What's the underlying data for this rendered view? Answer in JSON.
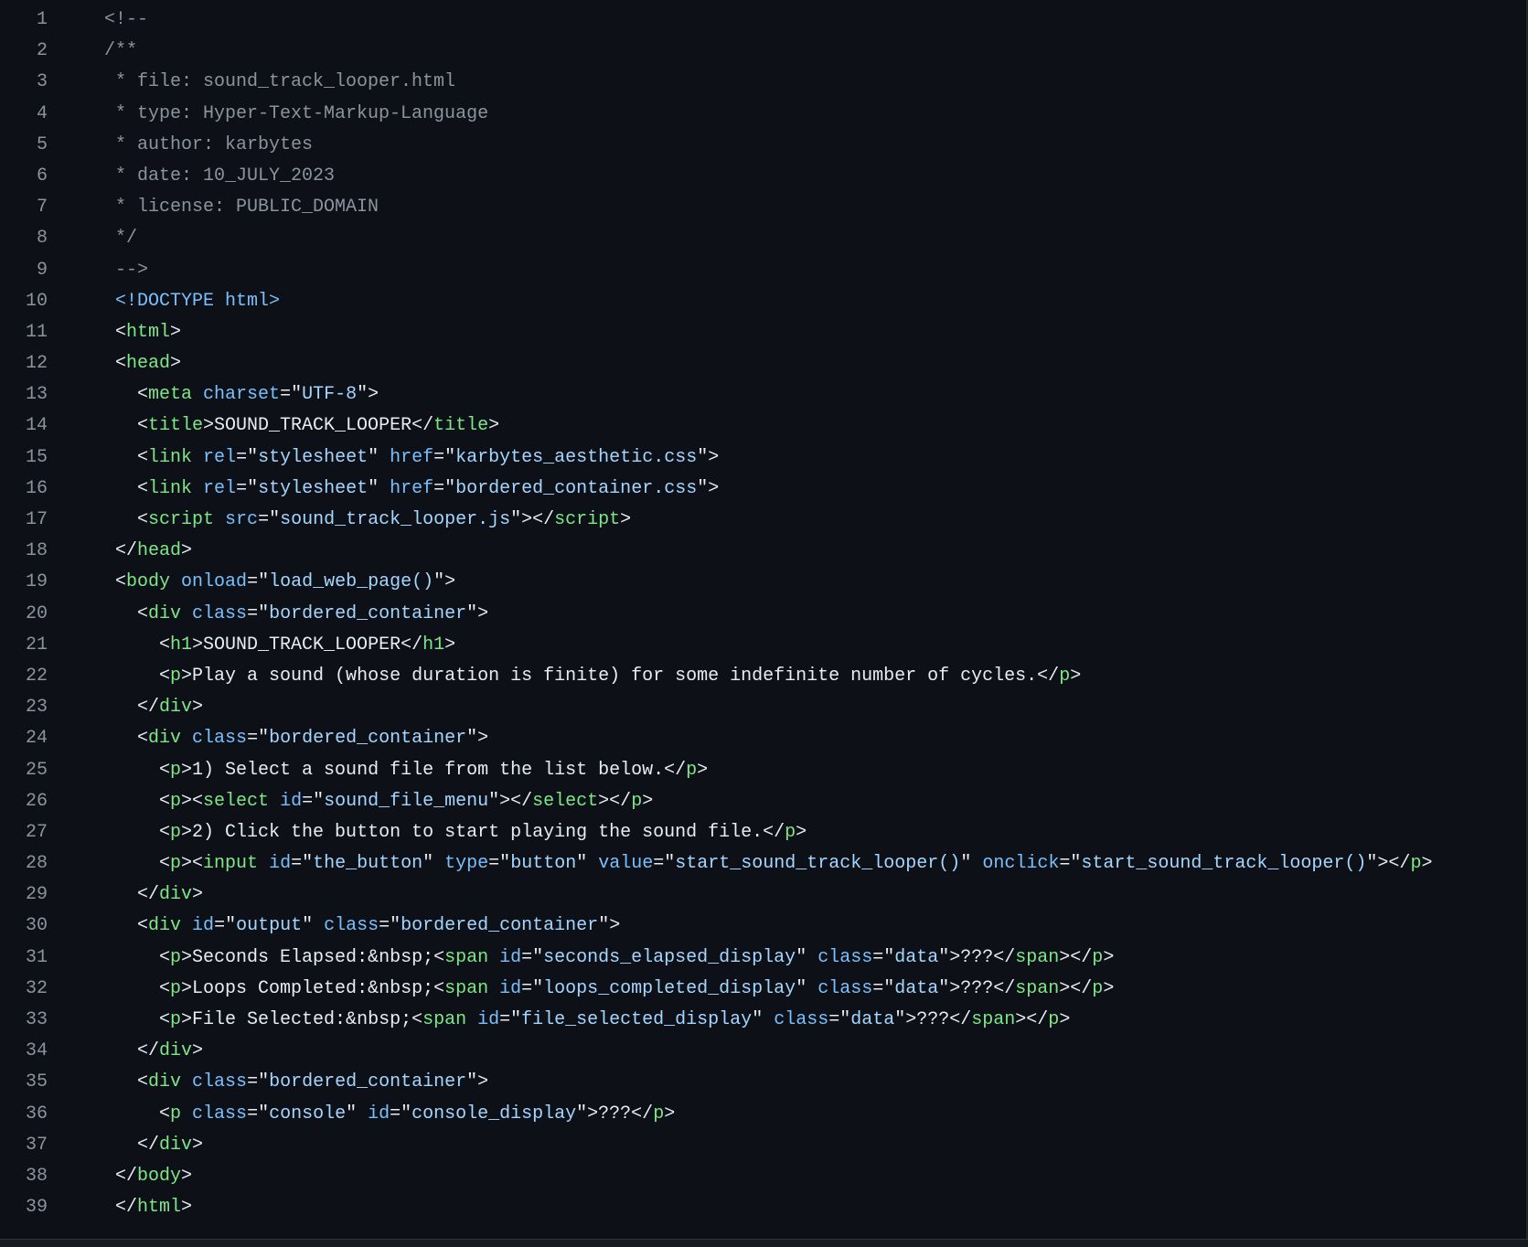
{
  "editor": {
    "lines": [
      [
        [
          "c",
          "<!--"
        ]
      ],
      [
        [
          "c",
          "/**"
        ]
      ],
      [
        [
          "c",
          " * file: sound_track_looper.html"
        ]
      ],
      [
        [
          "c",
          " * type: Hyper-Text-Markup-Language"
        ]
      ],
      [
        [
          "c",
          " * author: karbytes"
        ]
      ],
      [
        [
          "c",
          " * date: 10_JULY_2023"
        ]
      ],
      [
        [
          "c",
          " * license: PUBLIC_DOMAIN"
        ]
      ],
      [
        [
          "c",
          " */"
        ]
      ],
      [
        [
          "c",
          " -->"
        ]
      ],
      [
        [
          "x",
          " "
        ],
        [
          "d",
          "<!DOCTYPE html>"
        ]
      ],
      [
        [
          "x",
          " <"
        ],
        [
          "t",
          "html"
        ],
        [
          "x",
          ">"
        ]
      ],
      [
        [
          "x",
          " <"
        ],
        [
          "t",
          "head"
        ],
        [
          "x",
          ">"
        ]
      ],
      [
        [
          "x",
          "   <"
        ],
        [
          "t",
          "meta"
        ],
        [
          "x",
          " "
        ],
        [
          "a",
          "charset"
        ],
        [
          "x",
          "=\""
        ],
        [
          "s",
          "UTF-8"
        ],
        [
          "x",
          "\">"
        ]
      ],
      [
        [
          "x",
          "   <"
        ],
        [
          "t",
          "title"
        ],
        [
          "x",
          ">SOUND_TRACK_LOOPER</"
        ],
        [
          "t",
          "title"
        ],
        [
          "x",
          ">"
        ]
      ],
      [
        [
          "x",
          "   <"
        ],
        [
          "t",
          "link"
        ],
        [
          "x",
          " "
        ],
        [
          "a",
          "rel"
        ],
        [
          "x",
          "=\""
        ],
        [
          "s",
          "stylesheet"
        ],
        [
          "x",
          "\" "
        ],
        [
          "a",
          "href"
        ],
        [
          "x",
          "=\""
        ],
        [
          "s",
          "karbytes_aesthetic.css"
        ],
        [
          "x",
          "\">"
        ]
      ],
      [
        [
          "x",
          "   <"
        ],
        [
          "t",
          "link"
        ],
        [
          "x",
          " "
        ],
        [
          "a",
          "rel"
        ],
        [
          "x",
          "=\""
        ],
        [
          "s",
          "stylesheet"
        ],
        [
          "x",
          "\" "
        ],
        [
          "a",
          "href"
        ],
        [
          "x",
          "=\""
        ],
        [
          "s",
          "bordered_container.css"
        ],
        [
          "x",
          "\">"
        ]
      ],
      [
        [
          "x",
          "   <"
        ],
        [
          "t",
          "script"
        ],
        [
          "x",
          " "
        ],
        [
          "a",
          "src"
        ],
        [
          "x",
          "=\""
        ],
        [
          "s",
          "sound_track_looper.js"
        ],
        [
          "x",
          "\"></"
        ],
        [
          "t",
          "script"
        ],
        [
          "x",
          ">"
        ]
      ],
      [
        [
          "x",
          " </"
        ],
        [
          "t",
          "head"
        ],
        [
          "x",
          ">"
        ]
      ],
      [
        [
          "x",
          " <"
        ],
        [
          "t",
          "body"
        ],
        [
          "x",
          " "
        ],
        [
          "a",
          "onload"
        ],
        [
          "x",
          "=\""
        ],
        [
          "s",
          "load_web_page()"
        ],
        [
          "x",
          "\">"
        ]
      ],
      [
        [
          "x",
          "   <"
        ],
        [
          "t",
          "div"
        ],
        [
          "x",
          " "
        ],
        [
          "a",
          "class"
        ],
        [
          "x",
          "=\""
        ],
        [
          "s",
          "bordered_container"
        ],
        [
          "x",
          "\">"
        ]
      ],
      [
        [
          "x",
          "     <"
        ],
        [
          "t",
          "h1"
        ],
        [
          "x",
          ">SOUND_TRACK_LOOPER</"
        ],
        [
          "t",
          "h1"
        ],
        [
          "x",
          ">"
        ]
      ],
      [
        [
          "x",
          "     <"
        ],
        [
          "t",
          "p"
        ],
        [
          "x",
          ">Play a sound (whose duration is finite) for some indefinite number of cycles.</"
        ],
        [
          "t",
          "p"
        ],
        [
          "x",
          ">"
        ]
      ],
      [
        [
          "x",
          "   </"
        ],
        [
          "t",
          "div"
        ],
        [
          "x",
          ">"
        ]
      ],
      [
        [
          "x",
          "   <"
        ],
        [
          "t",
          "div"
        ],
        [
          "x",
          " "
        ],
        [
          "a",
          "class"
        ],
        [
          "x",
          "=\""
        ],
        [
          "s",
          "bordered_container"
        ],
        [
          "x",
          "\">"
        ]
      ],
      [
        [
          "x",
          "     <"
        ],
        [
          "t",
          "p"
        ],
        [
          "x",
          ">1) Select a sound file from the list below.</"
        ],
        [
          "t",
          "p"
        ],
        [
          "x",
          ">"
        ]
      ],
      [
        [
          "x",
          "     <"
        ],
        [
          "t",
          "p"
        ],
        [
          "x",
          "><"
        ],
        [
          "t",
          "select"
        ],
        [
          "x",
          " "
        ],
        [
          "a",
          "id"
        ],
        [
          "x",
          "=\""
        ],
        [
          "s",
          "sound_file_menu"
        ],
        [
          "x",
          "\"></"
        ],
        [
          "t",
          "select"
        ],
        [
          "x",
          "></"
        ],
        [
          "t",
          "p"
        ],
        [
          "x",
          ">"
        ]
      ],
      [
        [
          "x",
          "     <"
        ],
        [
          "t",
          "p"
        ],
        [
          "x",
          ">2) Click the button to start playing the sound file.</"
        ],
        [
          "t",
          "p"
        ],
        [
          "x",
          ">"
        ]
      ],
      [
        [
          "x",
          "     <"
        ],
        [
          "t",
          "p"
        ],
        [
          "x",
          "><"
        ],
        [
          "t",
          "input"
        ],
        [
          "x",
          " "
        ],
        [
          "a",
          "id"
        ],
        [
          "x",
          "=\""
        ],
        [
          "s",
          "the_button"
        ],
        [
          "x",
          "\" "
        ],
        [
          "a",
          "type"
        ],
        [
          "x",
          "=\""
        ],
        [
          "s",
          "button"
        ],
        [
          "x",
          "\" "
        ],
        [
          "a",
          "value"
        ],
        [
          "x",
          "=\""
        ],
        [
          "s",
          "start_sound_track_looper()"
        ],
        [
          "x",
          "\" "
        ],
        [
          "a",
          "onclick"
        ],
        [
          "x",
          "=\""
        ],
        [
          "s",
          "start_sound_track_looper()"
        ],
        [
          "x",
          "\"></"
        ],
        [
          "t",
          "p"
        ],
        [
          "x",
          ">"
        ]
      ],
      [
        [
          "x",
          "   </"
        ],
        [
          "t",
          "div"
        ],
        [
          "x",
          ">"
        ]
      ],
      [
        [
          "x",
          "   <"
        ],
        [
          "t",
          "div"
        ],
        [
          "x",
          " "
        ],
        [
          "a",
          "id"
        ],
        [
          "x",
          "=\""
        ],
        [
          "s",
          "output"
        ],
        [
          "x",
          "\" "
        ],
        [
          "a",
          "class"
        ],
        [
          "x",
          "=\""
        ],
        [
          "s",
          "bordered_container"
        ],
        [
          "x",
          "\">"
        ]
      ],
      [
        [
          "x",
          "     <"
        ],
        [
          "t",
          "p"
        ],
        [
          "x",
          ">Seconds Elapsed:&nbsp;<"
        ],
        [
          "t",
          "span"
        ],
        [
          "x",
          " "
        ],
        [
          "a",
          "id"
        ],
        [
          "x",
          "=\""
        ],
        [
          "s",
          "seconds_elapsed_display"
        ],
        [
          "x",
          "\" "
        ],
        [
          "a",
          "class"
        ],
        [
          "x",
          "=\""
        ],
        [
          "s",
          "data"
        ],
        [
          "x",
          "\">???</"
        ],
        [
          "t",
          "span"
        ],
        [
          "x",
          "></"
        ],
        [
          "t",
          "p"
        ],
        [
          "x",
          ">"
        ]
      ],
      [
        [
          "x",
          "     <"
        ],
        [
          "t",
          "p"
        ],
        [
          "x",
          ">Loops Completed:&nbsp;<"
        ],
        [
          "t",
          "span"
        ],
        [
          "x",
          " "
        ],
        [
          "a",
          "id"
        ],
        [
          "x",
          "=\""
        ],
        [
          "s",
          "loops_completed_display"
        ],
        [
          "x",
          "\" "
        ],
        [
          "a",
          "class"
        ],
        [
          "x",
          "=\""
        ],
        [
          "s",
          "data"
        ],
        [
          "x",
          "\">???</"
        ],
        [
          "t",
          "span"
        ],
        [
          "x",
          "></"
        ],
        [
          "t",
          "p"
        ],
        [
          "x",
          ">"
        ]
      ],
      [
        [
          "x",
          "     <"
        ],
        [
          "t",
          "p"
        ],
        [
          "x",
          ">File Selected:&nbsp;<"
        ],
        [
          "t",
          "span"
        ],
        [
          "x",
          " "
        ],
        [
          "a",
          "id"
        ],
        [
          "x",
          "=\""
        ],
        [
          "s",
          "file_selected_display"
        ],
        [
          "x",
          "\" "
        ],
        [
          "a",
          "class"
        ],
        [
          "x",
          "=\""
        ],
        [
          "s",
          "data"
        ],
        [
          "x",
          "\">???</"
        ],
        [
          "t",
          "span"
        ],
        [
          "x",
          "></"
        ],
        [
          "t",
          "p"
        ],
        [
          "x",
          ">"
        ]
      ],
      [
        [
          "x",
          "   </"
        ],
        [
          "t",
          "div"
        ],
        [
          "x",
          ">"
        ]
      ],
      [
        [
          "x",
          "   <"
        ],
        [
          "t",
          "div"
        ],
        [
          "x",
          " "
        ],
        [
          "a",
          "class"
        ],
        [
          "x",
          "=\""
        ],
        [
          "s",
          "bordered_container"
        ],
        [
          "x",
          "\">"
        ]
      ],
      [
        [
          "x",
          "     <"
        ],
        [
          "t",
          "p"
        ],
        [
          "x",
          " "
        ],
        [
          "a",
          "class"
        ],
        [
          "x",
          "=\""
        ],
        [
          "s",
          "console"
        ],
        [
          "x",
          "\" "
        ],
        [
          "a",
          "id"
        ],
        [
          "x",
          "=\""
        ],
        [
          "s",
          "console_display"
        ],
        [
          "x",
          "\">???</"
        ],
        [
          "t",
          "p"
        ],
        [
          "x",
          ">"
        ]
      ],
      [
        [
          "x",
          "   </"
        ],
        [
          "t",
          "div"
        ],
        [
          "x",
          ">"
        ]
      ],
      [
        [
          "x",
          " </"
        ],
        [
          "t",
          "body"
        ],
        [
          "x",
          ">"
        ]
      ],
      [
        [
          "x",
          " </"
        ],
        [
          "t",
          "html"
        ],
        [
          "x",
          ">"
        ]
      ]
    ]
  },
  "colors": {
    "background": "#0d1117",
    "line_number": "#8b949e",
    "comment": "#8b949e",
    "tag": "#7ee787",
    "attribute": "#79c0ff",
    "string": "#a5d6ff",
    "plain": "#e6edf3"
  }
}
